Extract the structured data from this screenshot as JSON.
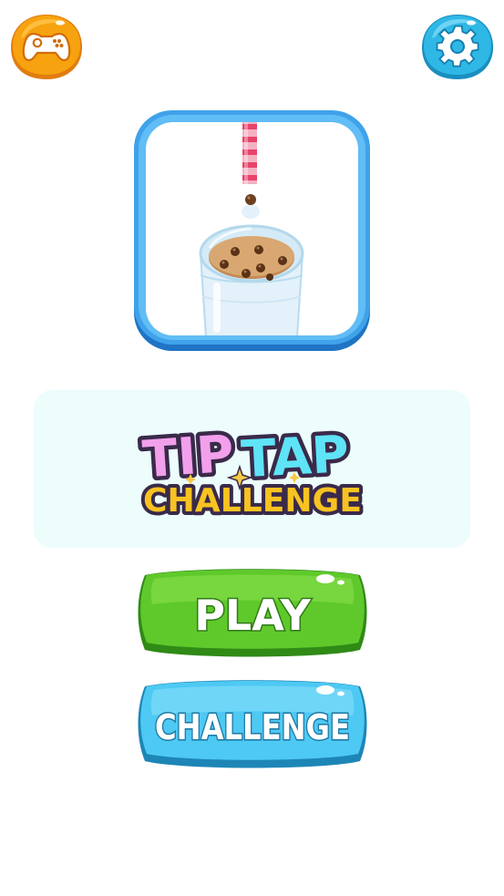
{
  "logo": {
    "line1_part1": "TIP",
    "line1_part2": "TAP",
    "line2": "CHALLENGE"
  },
  "menu": {
    "play_label": "PLAY",
    "challenge_label": "CHALLENGE"
  },
  "icons": {
    "top_left": "gamepad-icon",
    "top_right": "gear-icon"
  },
  "colors": {
    "gamepad_orange": "#f7a20f",
    "settings_blue": "#2fb8e6",
    "card_border": "#2b93de",
    "logo_panel_bg": "#ecfdfc",
    "play_green": "#5fc92b",
    "challenge_blue": "#4ec9f3"
  }
}
